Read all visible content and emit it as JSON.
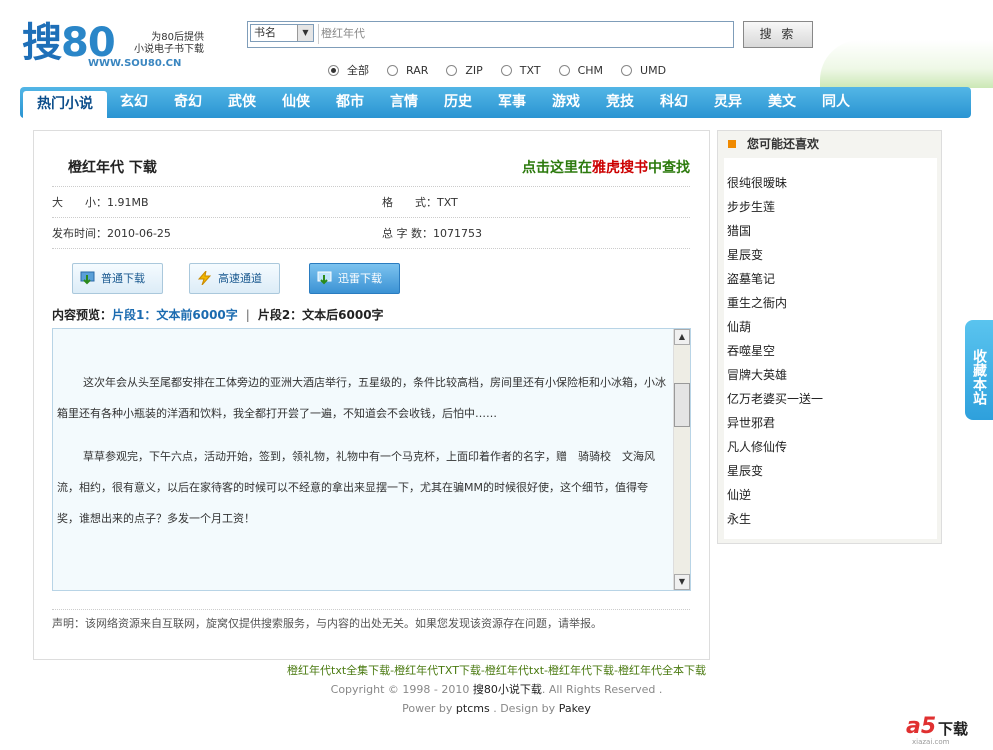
{
  "logo": {
    "text": "搜",
    "num": "80",
    "url": "WWW.SOU80.CN",
    "tagline1": "为80后提供",
    "tagline2": "小说电子书下载"
  },
  "search": {
    "select_value": "书名",
    "input_value": "橙红年代",
    "button": "搜 索"
  },
  "formats": [
    {
      "label": "全部",
      "checked": true
    },
    {
      "label": "RAR",
      "checked": false
    },
    {
      "label": "ZIP",
      "checked": false
    },
    {
      "label": "TXT",
      "checked": false
    },
    {
      "label": "CHM",
      "checked": false
    },
    {
      "label": "UMD",
      "checked": false
    }
  ],
  "nav": [
    "热门小说",
    "玄幻",
    "奇幻",
    "武侠",
    "仙侠",
    "都市",
    "言情",
    "历史",
    "军事",
    "游戏",
    "竞技",
    "科幻",
    "灵异",
    "美文",
    "同人"
  ],
  "book": {
    "title": "橙红年代  下载",
    "find_prefix": "点击这里在",
    "find_brand": "雅虎搜书",
    "find_suffix": "中查找",
    "size_label": "大　　小：",
    "size": "1.91MB",
    "format_label": "格　　式：",
    "format": "TXT",
    "date_label": "发布时间：",
    "date": "2010-06-25",
    "words_label": "总 字 数：",
    "words": "1071753"
  },
  "downloads": {
    "normal": "普通下载",
    "fast": "高速通道",
    "xunlei": "迅雷下载"
  },
  "preview": {
    "label": "内容预览：",
    "part1": "片段1：文本前6000字",
    "sep": "|",
    "part2": "片段2：文本后6000字",
    "para1": "这次年会从头至尾都安排在工体旁边的亚洲大酒店举行，五星级的，条件比较高档，房间里还有小保险柜和小冰箱，小冰箱里还有各种小瓶装的洋酒和饮料，我全都打开尝了一遍，不知道会不会收钱，后怕中……",
    "para2": "草草参观完，下午六点，活动开始，签到，领礼物，礼物中有一个马克杯，上面印着作者的名字，赠　骑骑校　文海风流，相约，很有意义，以后在家待客的时候可以不经意的拿出来显摆一下，尤其在骗MM的时候很好使，这个细节，值得夸奖，谁想出来的点子？多发一个月工资！"
  },
  "disclaimer": "声明：该网络资源来自互联网，旋窝仅提供搜索服务，与内容的出处无关。如果您发现该资源存在问题，请举报。",
  "sidebar": {
    "title": "您可能还喜欢",
    "items": [
      "很纯很暧昧",
      "步步生莲",
      "猎国",
      "星辰变",
      "盗墓笔记",
      "重生之衙内",
      "仙葫",
      "吞噬星空",
      "冒牌大英雄",
      "亿万老婆买一送一",
      "异世邪君",
      "凡人修仙传",
      "星辰变",
      "仙逆",
      "永生"
    ]
  },
  "fav": "收藏本站",
  "footer": {
    "keywords": "橙红年代txt全集下载-橙红年代TXT下载-橙红年代txt-橙红年代下载-橙红年代全本下载",
    "copy_prefix": "Copyright © 1998 - 2010 ",
    "copy_brand": "搜80小说下载",
    "copy_suffix": ". All Rights Reserved .",
    "power_prefix": "Power by ",
    "power_name": "ptcms",
    "power_mid": " . Design by ",
    "power_designer": "Pakey"
  },
  "watermark": {
    "logo": "a5",
    "text": "下载",
    "site": "xiazai.com"
  },
  "colors": {
    "nav": "#2a94d2",
    "accent_green": "#2c7a0d",
    "accent_red": "#cc0000",
    "link": "#1b6bb0"
  }
}
